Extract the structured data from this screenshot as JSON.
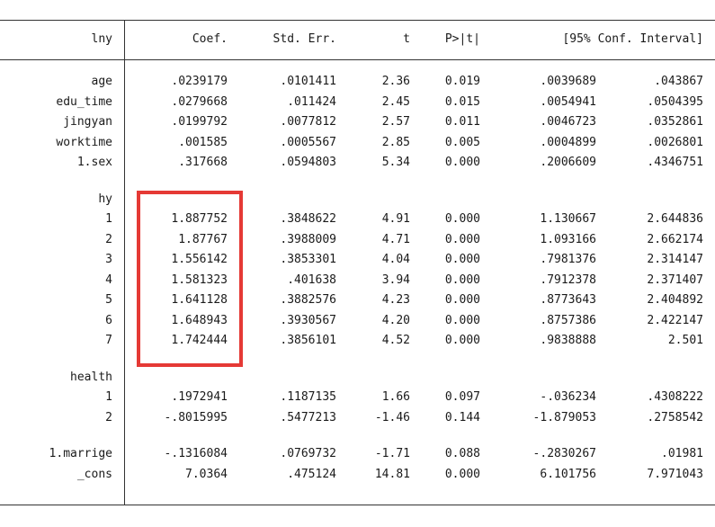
{
  "header": [
    "lny",
    "Coef.",
    "Std. Err.",
    "t",
    "P>|t|",
    "[95% Conf. Interval]"
  ],
  "sections": [
    {
      "label": "",
      "rows": [
        {
          "name": "age",
          "values": [
            ".0239179",
            ".0101411",
            "2.36",
            "0.019",
            ".0039689",
            ".043867"
          ]
        },
        {
          "name": "edu_time",
          "values": [
            ".0279668",
            ".011424",
            "2.45",
            "0.015",
            ".0054941",
            ".0504395"
          ]
        },
        {
          "name": "jingyan",
          "values": [
            ".0199792",
            ".0077812",
            "2.57",
            "0.011",
            ".0046723",
            ".0352861"
          ]
        },
        {
          "name": "worktime",
          "values": [
            ".001585",
            ".0005567",
            "2.85",
            "0.005",
            ".0004899",
            ".0026801"
          ]
        },
        {
          "name": "1.sex",
          "values": [
            ".317668",
            ".0594803",
            "5.34",
            "0.000",
            ".2006609",
            ".4346751"
          ]
        }
      ]
    },
    {
      "label": "hy",
      "rows": [
        {
          "name": "1",
          "values": [
            "1.887752",
            ".3848622",
            "4.91",
            "0.000",
            "1.130667",
            "2.644836"
          ]
        },
        {
          "name": "2",
          "values": [
            "1.87767",
            ".3988009",
            "4.71",
            "0.000",
            "1.093166",
            "2.662174"
          ]
        },
        {
          "name": "3",
          "values": [
            "1.556142",
            ".3853301",
            "4.04",
            "0.000",
            ".7981376",
            "2.314147"
          ]
        },
        {
          "name": "4",
          "values": [
            "1.581323",
            ".401638",
            "3.94",
            "0.000",
            ".7912378",
            "2.371407"
          ]
        },
        {
          "name": "5",
          "values": [
            "1.641128",
            ".3882576",
            "4.23",
            "0.000",
            ".8773643",
            "2.404892"
          ]
        },
        {
          "name": "6",
          "values": [
            "1.648943",
            ".3930567",
            "4.20",
            "0.000",
            ".8757386",
            "2.422147"
          ]
        },
        {
          "name": "7",
          "values": [
            "1.742444",
            ".3856101",
            "4.52",
            "0.000",
            ".9838888",
            "2.501"
          ]
        }
      ]
    },
    {
      "label": "health",
      "rows": [
        {
          "name": "1",
          "values": [
            ".1972941",
            ".1187135",
            "1.66",
            "0.097",
            "-.036234",
            ".4308222"
          ]
        },
        {
          "name": "2",
          "values": [
            "-.8015995",
            ".5477213",
            "-1.46",
            "0.144",
            "-1.879053",
            ".2758542"
          ]
        }
      ]
    },
    {
      "label": "",
      "rows": [
        {
          "name": "1.marrige",
          "values": [
            "-.1316084",
            ".0769732",
            "-1.71",
            "0.088",
            "-.2830267",
            ".01981"
          ]
        },
        {
          "name": "_cons",
          "values": [
            "7.0364",
            ".475124",
            "14.81",
            "0.000",
            "6.101756",
            "7.971043"
          ]
        }
      ]
    }
  ],
  "highlight": {
    "section": "hy",
    "column": "Coef.",
    "color": "#e53935"
  }
}
